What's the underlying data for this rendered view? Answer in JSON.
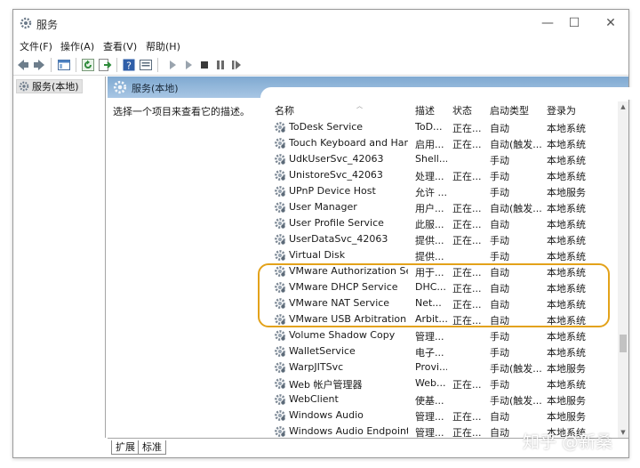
{
  "window": {
    "title": "服务",
    "minimize": "—",
    "maximize": "☐",
    "close": "✕"
  },
  "menu": [
    "文件(F)",
    "操作(A)",
    "查看(V)",
    "帮助(H)"
  ],
  "toolbar": [
    "back-icon",
    "forward-icon",
    "console-tree-icon",
    "refresh-icon",
    "export-icon",
    "help-icon",
    "properties-icon",
    "start-icon",
    "start-alt-icon",
    "stop-icon",
    "pause-icon",
    "restart-icon"
  ],
  "tree": {
    "item": "服务(本地)"
  },
  "pane": {
    "header": "服务(本地)",
    "description": "选择一个项目来查看它的描述。"
  },
  "columns": {
    "name": "名称",
    "desc": "描述",
    "status": "状态",
    "start": "启动类型",
    "logon": "登录为"
  },
  "services": [
    {
      "name": "ToDesk Service",
      "desc": "ToD...",
      "status": "正在...",
      "start": "自动",
      "logon": "本地系统"
    },
    {
      "name": "Touch Keyboard and Hand...",
      "desc": "启用...",
      "status": "正在...",
      "start": "自动(触发...",
      "logon": "本地系统"
    },
    {
      "name": "UdkUserSvc_42063",
      "desc": "Shell...",
      "status": "",
      "start": "手动",
      "logon": "本地系统"
    },
    {
      "name": "UnistoreSvc_42063",
      "desc": "处理...",
      "status": "正在...",
      "start": "手动",
      "logon": "本地系统"
    },
    {
      "name": "UPnP Device Host",
      "desc": "允许 ...",
      "status": "",
      "start": "手动",
      "logon": "本地服务"
    },
    {
      "name": "User Manager",
      "desc": "用户...",
      "status": "正在...",
      "start": "自动(触发...",
      "logon": "本地系统"
    },
    {
      "name": "User Profile Service",
      "desc": "此服...",
      "status": "正在...",
      "start": "自动",
      "logon": "本地系统"
    },
    {
      "name": "UserDataSvc_42063",
      "desc": "提供...",
      "status": "正在...",
      "start": "手动",
      "logon": "本地系统"
    },
    {
      "name": "Virtual Disk",
      "desc": "提供...",
      "status": "",
      "start": "手动",
      "logon": "本地系统"
    },
    {
      "name": "VMware Authorization Ser...",
      "desc": "用于...",
      "status": "正在...",
      "start": "自动",
      "logon": "本地系统"
    },
    {
      "name": "VMware DHCP Service",
      "desc": "DHC...",
      "status": "正在...",
      "start": "自动",
      "logon": "本地系统"
    },
    {
      "name": "VMware NAT Service",
      "desc": "Net...",
      "status": "正在...",
      "start": "自动",
      "logon": "本地系统"
    },
    {
      "name": "VMware USB Arbitration S...",
      "desc": "Arbit...",
      "status": "正在...",
      "start": "自动",
      "logon": "本地系统"
    },
    {
      "name": "Volume Shadow Copy",
      "desc": "管理...",
      "status": "",
      "start": "手动",
      "logon": "本地系统"
    },
    {
      "name": "WalletService",
      "desc": "电子...",
      "status": "",
      "start": "手动",
      "logon": "本地系统"
    },
    {
      "name": "WarpJITSvc",
      "desc": "Provi...",
      "status": "",
      "start": "手动(触发...",
      "logon": "本地服务"
    },
    {
      "name": "Web 帐户管理器",
      "desc": "Web...",
      "status": "正在...",
      "start": "手动",
      "logon": "本地系统"
    },
    {
      "name": "WebClient",
      "desc": "使基...",
      "status": "",
      "start": "手动(触发...",
      "logon": "本地服务"
    },
    {
      "name": "Windows Audio",
      "desc": "管理...",
      "status": "正在...",
      "start": "自动",
      "logon": "本地服务"
    },
    {
      "name": "Windows Audio Endpoint B...",
      "desc": "管理...",
      "status": "正在...",
      "start": "自动",
      "logon": "本地系统"
    }
  ],
  "tabs": [
    "扩展",
    "标准"
  ],
  "watermark": "知乎 @新桑",
  "colors": {
    "header_blue": "#7fa9d1",
    "highlight": "#e3a21a"
  }
}
